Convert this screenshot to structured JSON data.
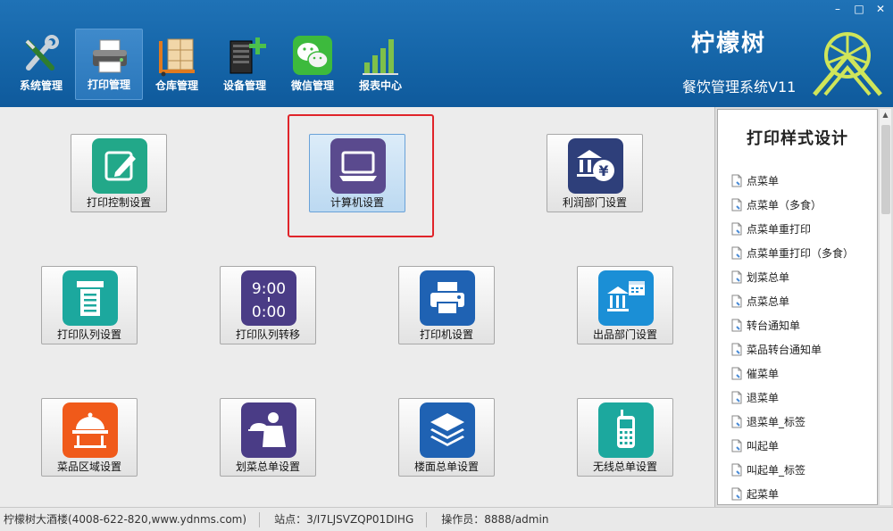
{
  "window_controls": {
    "minimize": "–",
    "maximize": "□",
    "close": "✕"
  },
  "toolbar": [
    {
      "label": "系统管理",
      "icon": "tools-icon",
      "active": false
    },
    {
      "label": "打印管理",
      "icon": "printer-icon",
      "active": true
    },
    {
      "label": "仓库管理",
      "icon": "warehouse-boxes-icon",
      "active": false
    },
    {
      "label": "设备管理",
      "icon": "server-add-icon",
      "active": false
    },
    {
      "label": "微信管理",
      "icon": "wechat-icon",
      "active": false
    },
    {
      "label": "报表中心",
      "icon": "bar-chart-icon",
      "active": false
    }
  ],
  "brand": {
    "title": "柠檬树",
    "subtitle": "餐饮管理系统V11"
  },
  "tiles": [
    {
      "label": "打印控制设置",
      "icon": "edit-icon"
    },
    {
      "label": "计算机设置",
      "icon": "computer-icon"
    },
    {
      "label": "利润部门设置",
      "icon": "bank-yen-icon"
    },
    {
      "label": "打印队列设置",
      "icon": "print-queue-icon"
    },
    {
      "label": "打印队列转移",
      "icon": "clock-display-icon",
      "icon_text_top": "9:00",
      "icon_text_bottom": "0:00"
    },
    {
      "label": "打印机设置",
      "icon": "printer-icon"
    },
    {
      "label": "出品部门设置",
      "icon": "department-calendar-icon"
    },
    {
      "label": "菜品区域设置",
      "icon": "food-cloche-icon"
    },
    {
      "label": "划菜总单设置",
      "icon": "waiter-icon"
    },
    {
      "label": "楼面总单设置",
      "icon": "layers-icon"
    },
    {
      "label": "无线总单设置",
      "icon": "mobile-phone-icon"
    }
  ],
  "panel": {
    "title": "打印样式设计",
    "items": [
      "点菜单",
      "点菜单（多食）",
      "点菜单重打印",
      "点菜单重打印（多食）",
      "划菜总单",
      "点菜总单",
      "转台通知单",
      "菜品转台通知单",
      "催菜单",
      "退菜单",
      "退菜单_标签",
      "叫起单",
      "叫起单_标签",
      "起菜单"
    ]
  },
  "status": {
    "company": "柠檬树大酒楼(4008-622-820,www.ydnms.com)",
    "station": "站点：3/I7LJSVZQP01DIHG",
    "operator": "操作员：8888/admin"
  },
  "colors": {
    "header": "#1565a8",
    "highlight": "#e0242a",
    "tile_hover": "#bcd9f1"
  }
}
